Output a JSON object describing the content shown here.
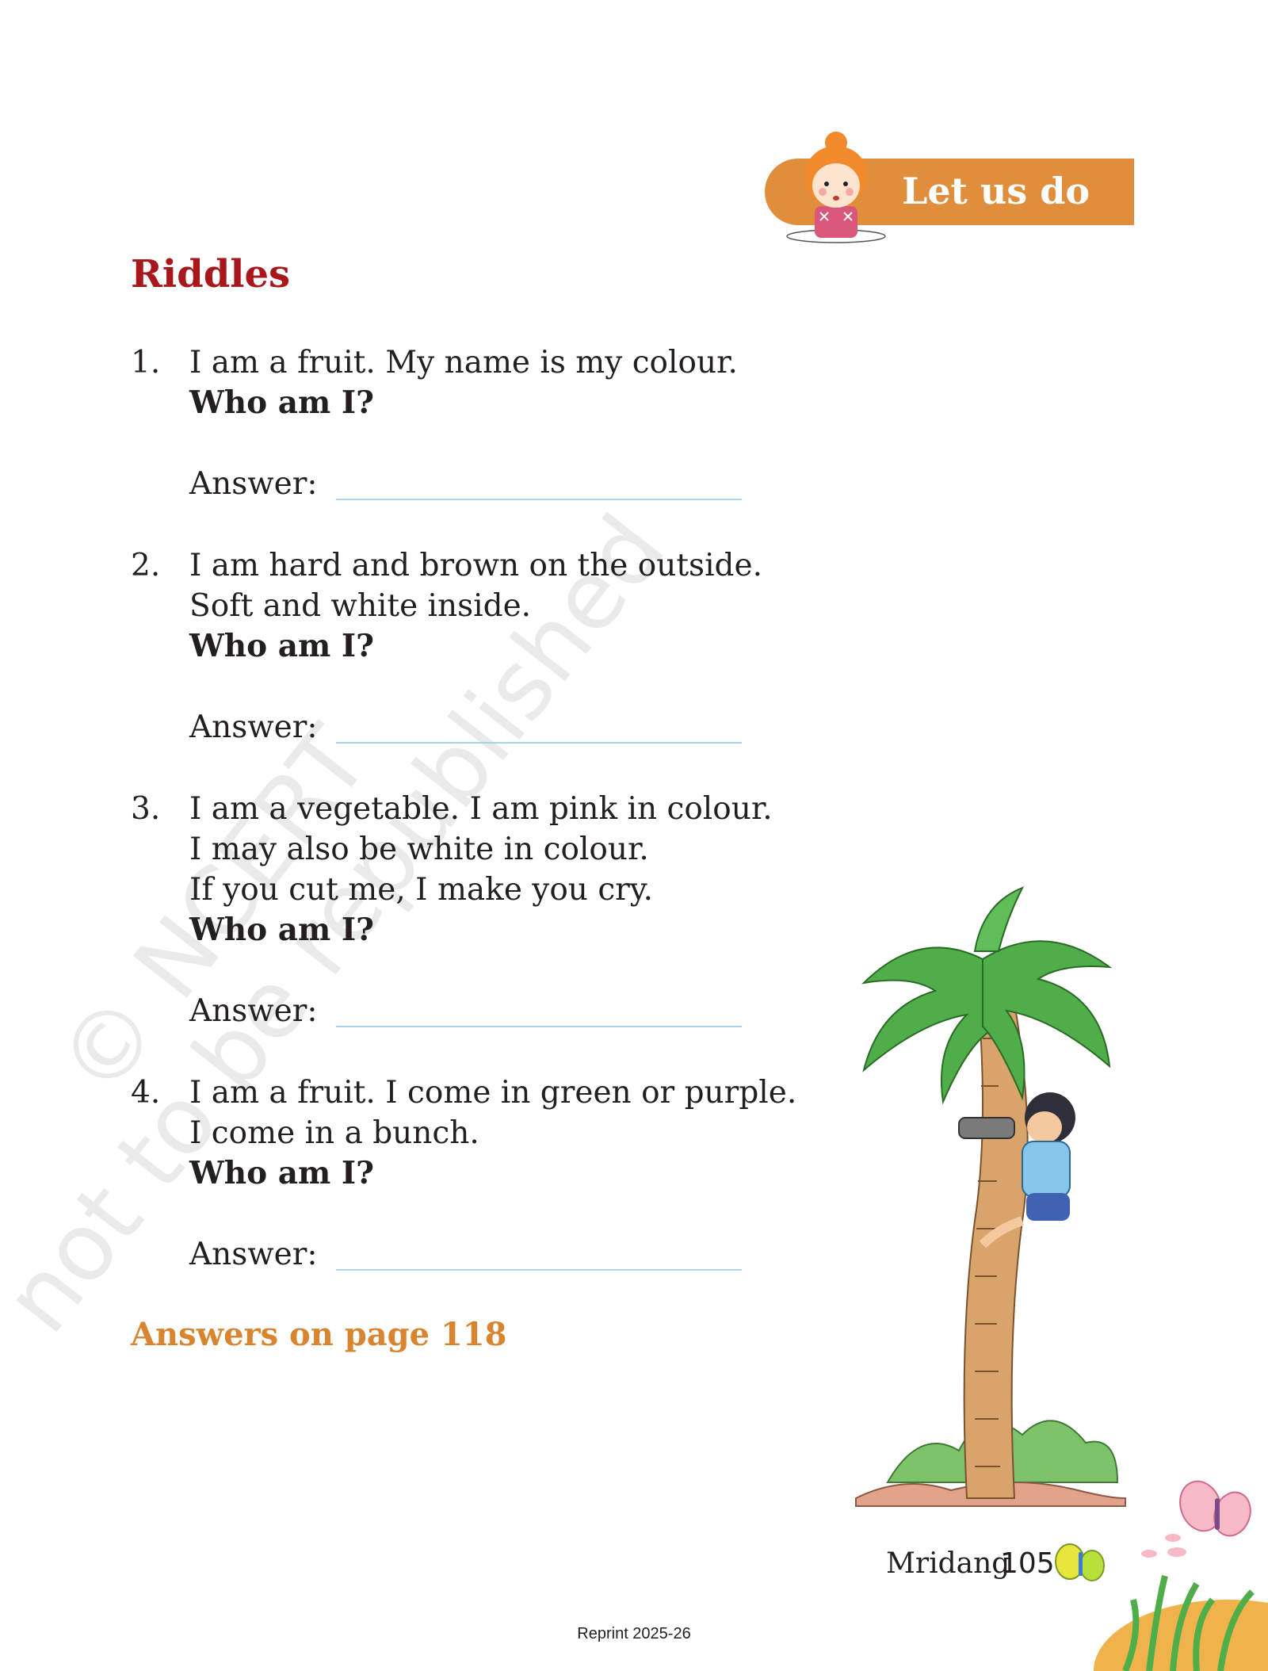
{
  "badge": {
    "text": "Let us do"
  },
  "heading": "Riddles",
  "riddles": [
    {
      "number": "1.",
      "lines": [
        "I am a fruit. My name is my colour."
      ],
      "question": "Who am I?",
      "answer_label": "Answer:"
    },
    {
      "number": "2.",
      "lines": [
        "I am hard and brown on the outside.",
        "Soft and white inside."
      ],
      "question": "Who am I?",
      "answer_label": "Answer:"
    },
    {
      "number": "3.",
      "lines": [
        "I am a vegetable. I am pink in colour.",
        "I may also be white in colour.",
        "If you cut me, I make you cry."
      ],
      "question": "Who am I?",
      "answer_label": "Answer:"
    },
    {
      "number": "4.",
      "lines": [
        "I am a fruit. I come in green or purple.",
        "I come in a bunch."
      ],
      "question": "Who am I?",
      "answer_label": "Answer:"
    }
  ],
  "answers_note": "Answers on page 118",
  "watermark": {
    "line1": "© NCERT",
    "line2": "not to be republished"
  },
  "footer": {
    "book_title": "Mridang",
    "page_number": "105",
    "reprint": "Reprint 2025-26"
  },
  "colors": {
    "heading": "#a8171c",
    "badge": "#e08d3c",
    "answers_note": "#d9852f",
    "answer_line": "#a9d2ea"
  }
}
